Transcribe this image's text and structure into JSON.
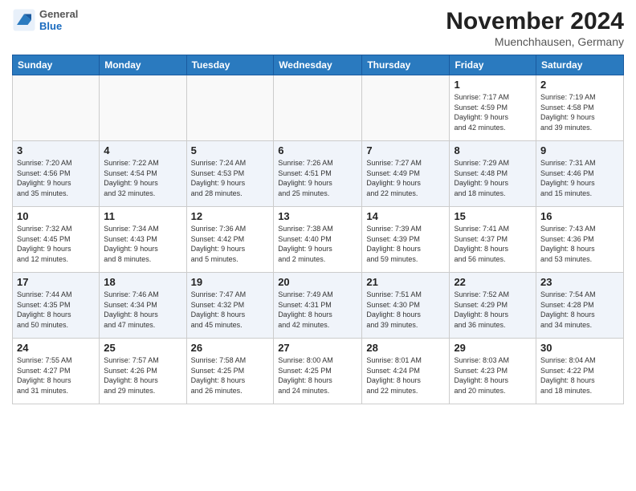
{
  "logo": {
    "general": "General",
    "blue": "Blue"
  },
  "title": "November 2024",
  "location": "Muenchhausen, Germany",
  "days_header": [
    "Sunday",
    "Monday",
    "Tuesday",
    "Wednesday",
    "Thursday",
    "Friday",
    "Saturday"
  ],
  "weeks": [
    [
      {
        "day": "",
        "info": ""
      },
      {
        "day": "",
        "info": ""
      },
      {
        "day": "",
        "info": ""
      },
      {
        "day": "",
        "info": ""
      },
      {
        "day": "",
        "info": ""
      },
      {
        "day": "1",
        "info": "Sunrise: 7:17 AM\nSunset: 4:59 PM\nDaylight: 9 hours\nand 42 minutes."
      },
      {
        "day": "2",
        "info": "Sunrise: 7:19 AM\nSunset: 4:58 PM\nDaylight: 9 hours\nand 39 minutes."
      }
    ],
    [
      {
        "day": "3",
        "info": "Sunrise: 7:20 AM\nSunset: 4:56 PM\nDaylight: 9 hours\nand 35 minutes."
      },
      {
        "day": "4",
        "info": "Sunrise: 7:22 AM\nSunset: 4:54 PM\nDaylight: 9 hours\nand 32 minutes."
      },
      {
        "day": "5",
        "info": "Sunrise: 7:24 AM\nSunset: 4:53 PM\nDaylight: 9 hours\nand 28 minutes."
      },
      {
        "day": "6",
        "info": "Sunrise: 7:26 AM\nSunset: 4:51 PM\nDaylight: 9 hours\nand 25 minutes."
      },
      {
        "day": "7",
        "info": "Sunrise: 7:27 AM\nSunset: 4:49 PM\nDaylight: 9 hours\nand 22 minutes."
      },
      {
        "day": "8",
        "info": "Sunrise: 7:29 AM\nSunset: 4:48 PM\nDaylight: 9 hours\nand 18 minutes."
      },
      {
        "day": "9",
        "info": "Sunrise: 7:31 AM\nSunset: 4:46 PM\nDaylight: 9 hours\nand 15 minutes."
      }
    ],
    [
      {
        "day": "10",
        "info": "Sunrise: 7:32 AM\nSunset: 4:45 PM\nDaylight: 9 hours\nand 12 minutes."
      },
      {
        "day": "11",
        "info": "Sunrise: 7:34 AM\nSunset: 4:43 PM\nDaylight: 9 hours\nand 8 minutes."
      },
      {
        "day": "12",
        "info": "Sunrise: 7:36 AM\nSunset: 4:42 PM\nDaylight: 9 hours\nand 5 minutes."
      },
      {
        "day": "13",
        "info": "Sunrise: 7:38 AM\nSunset: 4:40 PM\nDaylight: 9 hours\nand 2 minutes."
      },
      {
        "day": "14",
        "info": "Sunrise: 7:39 AM\nSunset: 4:39 PM\nDaylight: 8 hours\nand 59 minutes."
      },
      {
        "day": "15",
        "info": "Sunrise: 7:41 AM\nSunset: 4:37 PM\nDaylight: 8 hours\nand 56 minutes."
      },
      {
        "day": "16",
        "info": "Sunrise: 7:43 AM\nSunset: 4:36 PM\nDaylight: 8 hours\nand 53 minutes."
      }
    ],
    [
      {
        "day": "17",
        "info": "Sunrise: 7:44 AM\nSunset: 4:35 PM\nDaylight: 8 hours\nand 50 minutes."
      },
      {
        "day": "18",
        "info": "Sunrise: 7:46 AM\nSunset: 4:34 PM\nDaylight: 8 hours\nand 47 minutes."
      },
      {
        "day": "19",
        "info": "Sunrise: 7:47 AM\nSunset: 4:32 PM\nDaylight: 8 hours\nand 45 minutes."
      },
      {
        "day": "20",
        "info": "Sunrise: 7:49 AM\nSunset: 4:31 PM\nDaylight: 8 hours\nand 42 minutes."
      },
      {
        "day": "21",
        "info": "Sunrise: 7:51 AM\nSunset: 4:30 PM\nDaylight: 8 hours\nand 39 minutes."
      },
      {
        "day": "22",
        "info": "Sunrise: 7:52 AM\nSunset: 4:29 PM\nDaylight: 8 hours\nand 36 minutes."
      },
      {
        "day": "23",
        "info": "Sunrise: 7:54 AM\nSunset: 4:28 PM\nDaylight: 8 hours\nand 34 minutes."
      }
    ],
    [
      {
        "day": "24",
        "info": "Sunrise: 7:55 AM\nSunset: 4:27 PM\nDaylight: 8 hours\nand 31 minutes."
      },
      {
        "day": "25",
        "info": "Sunrise: 7:57 AM\nSunset: 4:26 PM\nDaylight: 8 hours\nand 29 minutes."
      },
      {
        "day": "26",
        "info": "Sunrise: 7:58 AM\nSunset: 4:25 PM\nDaylight: 8 hours\nand 26 minutes."
      },
      {
        "day": "27",
        "info": "Sunrise: 8:00 AM\nSunset: 4:25 PM\nDaylight: 8 hours\nand 24 minutes."
      },
      {
        "day": "28",
        "info": "Sunrise: 8:01 AM\nSunset: 4:24 PM\nDaylight: 8 hours\nand 22 minutes."
      },
      {
        "day": "29",
        "info": "Sunrise: 8:03 AM\nSunset: 4:23 PM\nDaylight: 8 hours\nand 20 minutes."
      },
      {
        "day": "30",
        "info": "Sunrise: 8:04 AM\nSunset: 4:22 PM\nDaylight: 8 hours\nand 18 minutes."
      }
    ]
  ]
}
